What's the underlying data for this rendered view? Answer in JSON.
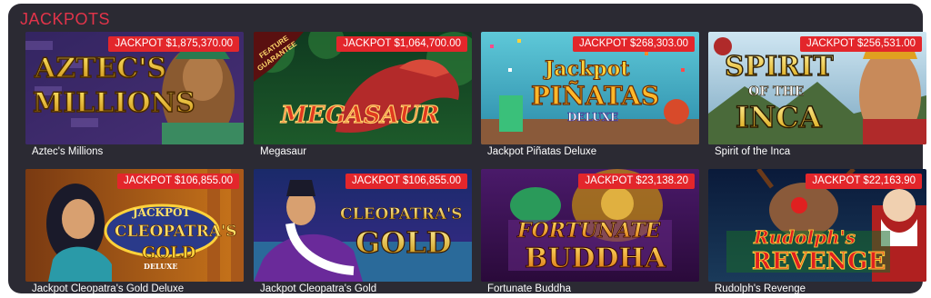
{
  "section": {
    "title": "JACKPOTS"
  },
  "games": [
    {
      "name": "Aztec's Millions",
      "jackpot": "JACKPOT $1,875,370.00",
      "logo_lines": [
        "AZTEC'S",
        "MILLIONS"
      ]
    },
    {
      "name": "Megasaur",
      "jackpot": "JACKPOT $1,064,700.00",
      "logo_lines": [
        "MEGASAUR"
      ],
      "ribbon": [
        "FEATURE",
        "GUARANTEE"
      ]
    },
    {
      "name": "Jackpot Piñatas Deluxe",
      "jackpot": "JACKPOT $268,303.00",
      "logo_lines": [
        "Jackpot",
        "PIÑATAS",
        "DELUXE"
      ]
    },
    {
      "name": "Spirit of the Inca",
      "jackpot": "JACKPOT $256,531.00",
      "logo_lines": [
        "SPIRIT",
        "OF THE",
        "INCA"
      ]
    },
    {
      "name": "Jackpot Cleopatra's Gold Deluxe",
      "jackpot": "JACKPOT $106,855.00",
      "logo_lines": [
        "JACKPOT",
        "CLEOPATRA'S",
        "GOLD",
        "DELUXE"
      ]
    },
    {
      "name": "Jackpot Cleopatra's Gold",
      "jackpot": "JACKPOT $106,855.00",
      "logo_lines": [
        "CLEOPATRA'S",
        "GOLD"
      ]
    },
    {
      "name": "Fortunate Buddha",
      "jackpot": "JACKPOT $23,138.20",
      "logo_lines": [
        "FORTUNATE",
        "BUDDHA"
      ]
    },
    {
      "name": "Rudolph's Revenge",
      "jackpot": "JACKPOT $22,163.90",
      "logo_lines": [
        "Rudolph's",
        "REVENGE"
      ]
    }
  ]
}
